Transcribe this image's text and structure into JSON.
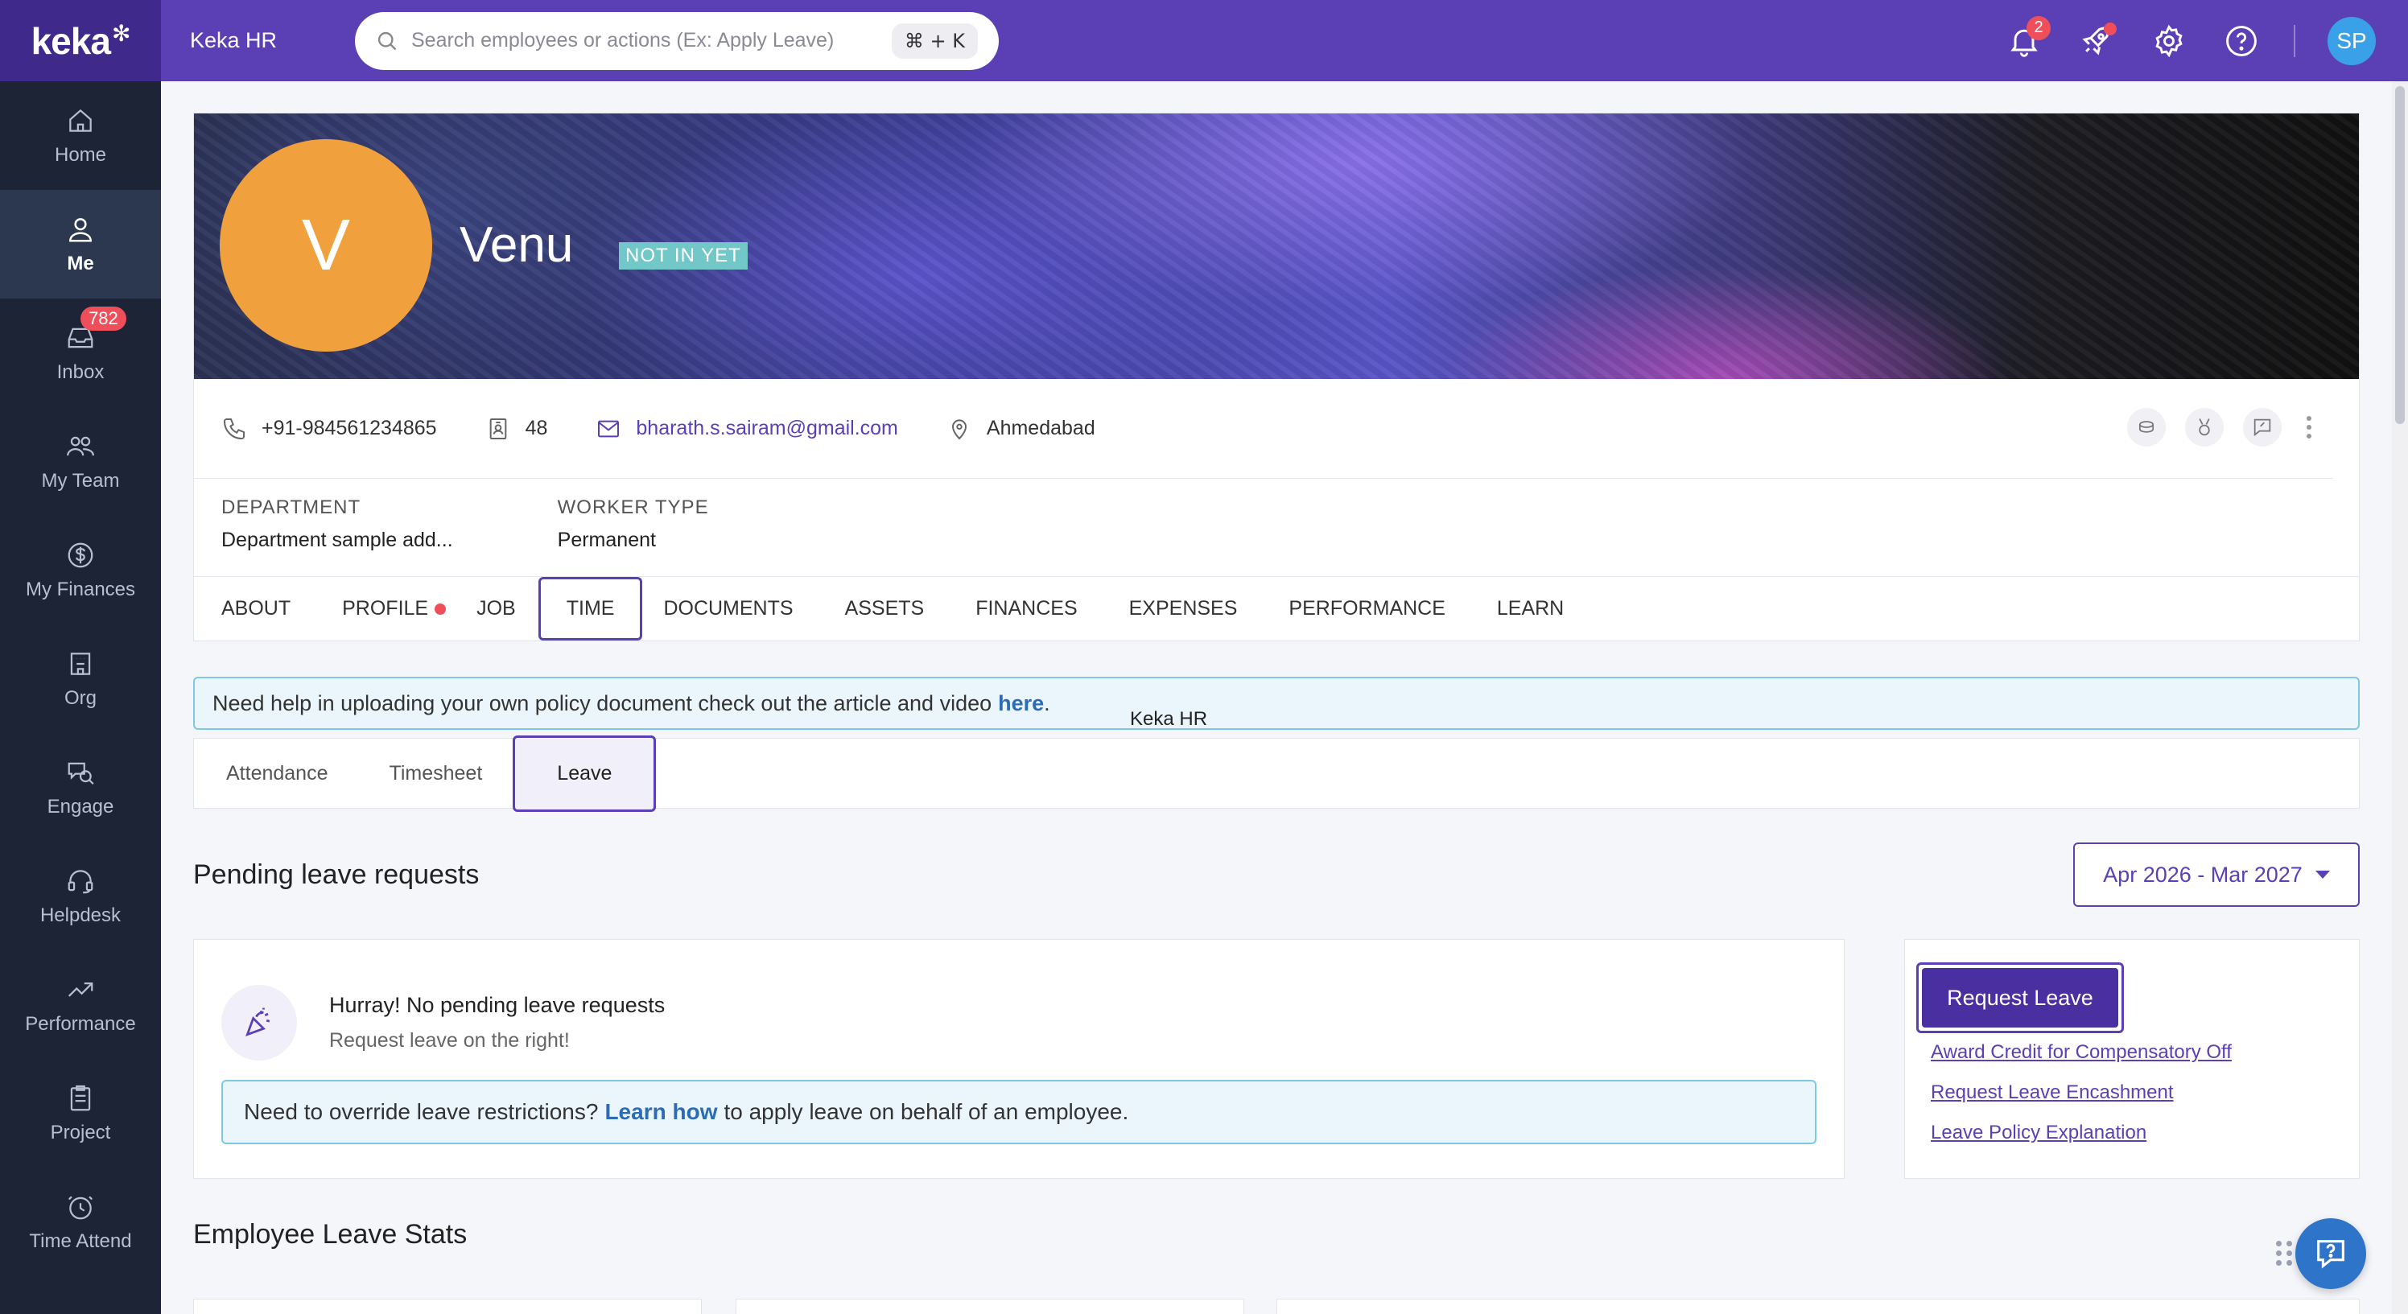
{
  "brand": {
    "logo_text": "keka",
    "org_name": "Keka HR"
  },
  "search": {
    "placeholder": "Search employees or actions (Ex: Apply Leave)",
    "shortcut": "⌘ + K"
  },
  "topbar": {
    "notifications_count": "2",
    "user_initials": "SP"
  },
  "sidebar": {
    "items": [
      {
        "label": "Home",
        "icon": "home-icon"
      },
      {
        "label": "Me",
        "icon": "user-icon",
        "active": true
      },
      {
        "label": "Inbox",
        "icon": "inbox-icon",
        "badge": "782"
      },
      {
        "label": "My Team",
        "icon": "team-icon"
      },
      {
        "label": "My Finances",
        "icon": "dollar-icon"
      },
      {
        "label": "Org",
        "icon": "org-icon"
      },
      {
        "label": "Engage",
        "icon": "engage-icon"
      },
      {
        "label": "Helpdesk",
        "icon": "headset-icon"
      },
      {
        "label": "Performance",
        "icon": "trend-icon"
      },
      {
        "label": "Project",
        "icon": "clipboard-icon"
      },
      {
        "label": "Time Attend",
        "icon": "clock-icon"
      }
    ]
  },
  "employee": {
    "initial": "V",
    "name": "Venu",
    "status": "NOT IN YET",
    "phone": "+91-984561234865",
    "employee_id": "48",
    "email": "bharath.s.sairam@gmail.com",
    "location": "Ahmedabad",
    "department_label": "DEPARTMENT",
    "department_value": "Department sample add...",
    "worker_type_label": "WORKER TYPE",
    "worker_type_value": "Permanent"
  },
  "tabs": [
    "ABOUT",
    "PROFILE",
    "JOB",
    "TIME",
    "DOCUMENTS",
    "ASSETS",
    "FINANCES",
    "EXPENSES",
    "PERFORMANCE",
    "LEARN"
  ],
  "help_banner": {
    "text": "Need help in uploading your own policy document check out the article and video",
    "link": "here",
    "suffix": "."
  },
  "subtabs": [
    "Attendance",
    "Timesheet",
    "Leave"
  ],
  "tooltip": "Keka HR",
  "pending": {
    "title": "Pending leave requests",
    "range": "Apr 2026 - Mar 2027",
    "empty_title": "Hurray! No pending leave requests",
    "empty_sub": "Request leave on the right!",
    "override_prefix": "Need to override leave restrictions?",
    "override_link": "Learn how",
    "override_suffix": "to apply leave on behalf of an employee."
  },
  "actions": {
    "request_leave": "Request Leave",
    "links": [
      "Award Credit for Compensatory Off",
      "Request Leave Encashment",
      "Leave Policy Explanation"
    ]
  },
  "stats": {
    "title": "Employee Leave Stats"
  },
  "colors": {
    "accent": "#5a3fb5",
    "sidebar": "#1d2435",
    "avatar": "#f0a03c"
  }
}
